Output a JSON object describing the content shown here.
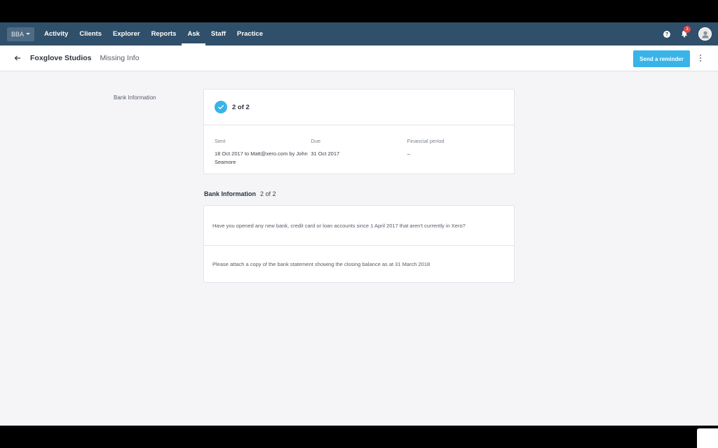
{
  "topnav": {
    "org_label": "BBA",
    "items": [
      {
        "label": "Activity",
        "active": false
      },
      {
        "label": "Clients",
        "active": false
      },
      {
        "label": "Explorer",
        "active": false
      },
      {
        "label": "Reports",
        "active": false
      },
      {
        "label": "Ask",
        "active": true
      },
      {
        "label": "Staff",
        "active": false
      },
      {
        "label": "Practice",
        "active": false
      }
    ],
    "help_icon": "?",
    "notification_count": "1"
  },
  "subheader": {
    "client_name": "Foxglove Studios",
    "page_title": "Missing Info",
    "reminder_button": "Send a reminder"
  },
  "section_label": "Bank Information",
  "status_card": {
    "status": "2 of 2",
    "sent_label": "Sent",
    "sent_value": "18 Oct 2017 to Matt@xero.com by John Seamore",
    "due_label": "Due",
    "due_value": "31 Oct 2017",
    "period_label": "Financial period",
    "period_value": "–"
  },
  "group": {
    "title": "Bank Information",
    "count": "2 of 2",
    "questions": [
      "Have you opened any new bank, credit card or loan accounts since 1 April 2017 that aren't currently in Xero?",
      "Please attach a copy of the bank statement showing the closing balance as at 31 March 2018"
    ]
  },
  "colors": {
    "nav_bg": "#2f4f6a",
    "accent": "#38b4e8",
    "badge": "#e24b4b",
    "page_bg": "#f5f5f7"
  }
}
